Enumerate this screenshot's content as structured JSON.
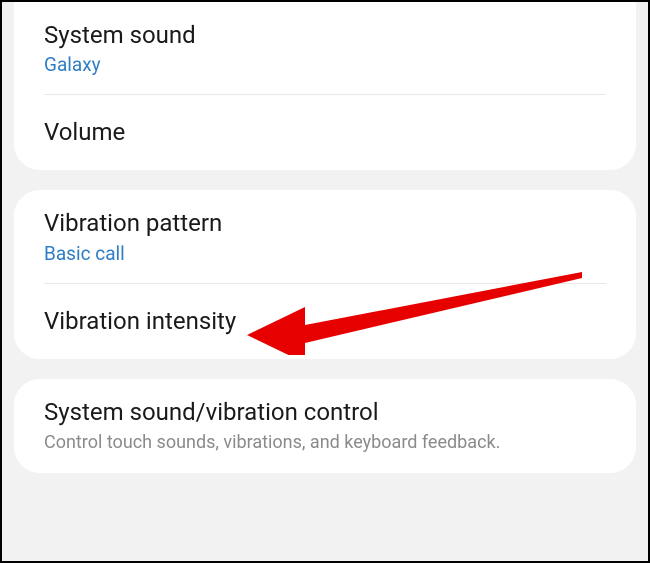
{
  "card1": {
    "row1": {
      "title": "System sound",
      "value": "Galaxy"
    },
    "row2": {
      "title": "Volume"
    }
  },
  "card2": {
    "row1": {
      "title": "Vibration pattern",
      "value": "Basic call"
    },
    "row2": {
      "title": "Vibration intensity"
    }
  },
  "card3": {
    "row1": {
      "title": "System sound/vibration control",
      "desc": "Control touch sounds, vibrations, and keyboard feedback."
    }
  }
}
